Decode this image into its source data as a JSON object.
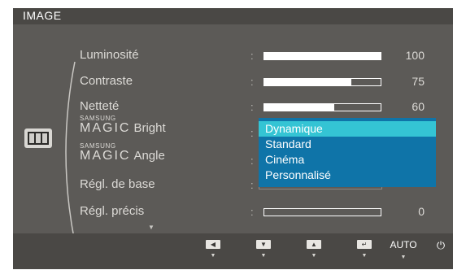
{
  "header": {
    "title": "IMAGE"
  },
  "menu": {
    "items": [
      {
        "label": "Luminosité",
        "value": "100",
        "level": 1.0
      },
      {
        "label": "Contraste",
        "value": "75",
        "level": 0.75
      },
      {
        "label": "Netteté",
        "value": "60",
        "level": 0.6
      },
      {
        "brand_top": "SAMSUNG",
        "brand_bottom": "MAGIC",
        "label": "Bright"
      },
      {
        "brand_top": "SAMSUNG",
        "brand_bottom": "MAGIC",
        "label": "Angle"
      },
      {
        "label": "Régl. de base"
      },
      {
        "label": "Régl. précis",
        "value": "0",
        "level": 0.0
      }
    ],
    "colon": ":",
    "more_indicator": "▼"
  },
  "dropdown": {
    "options": [
      "Dynamique",
      "Standard",
      "Cinéma",
      "Personnalisé"
    ],
    "selected": "Dynamique"
  },
  "nav": {
    "left_icon": "left-arrow-icon",
    "down_icon": "down-arrow-icon",
    "up_icon": "up-arrow-icon",
    "enter_icon": "enter-icon",
    "auto_label": "AUTO",
    "power_icon": "power-icon",
    "glyphs": {
      "left": "◀",
      "down": "▼",
      "up": "▲",
      "enter": "↵",
      "power": "⏻",
      "tri": "▼"
    }
  },
  "colors": {
    "panel": "#5c5a57",
    "bar": "#4a4845",
    "dropdown": "#0f74a8",
    "selected": "#34c4d4"
  }
}
